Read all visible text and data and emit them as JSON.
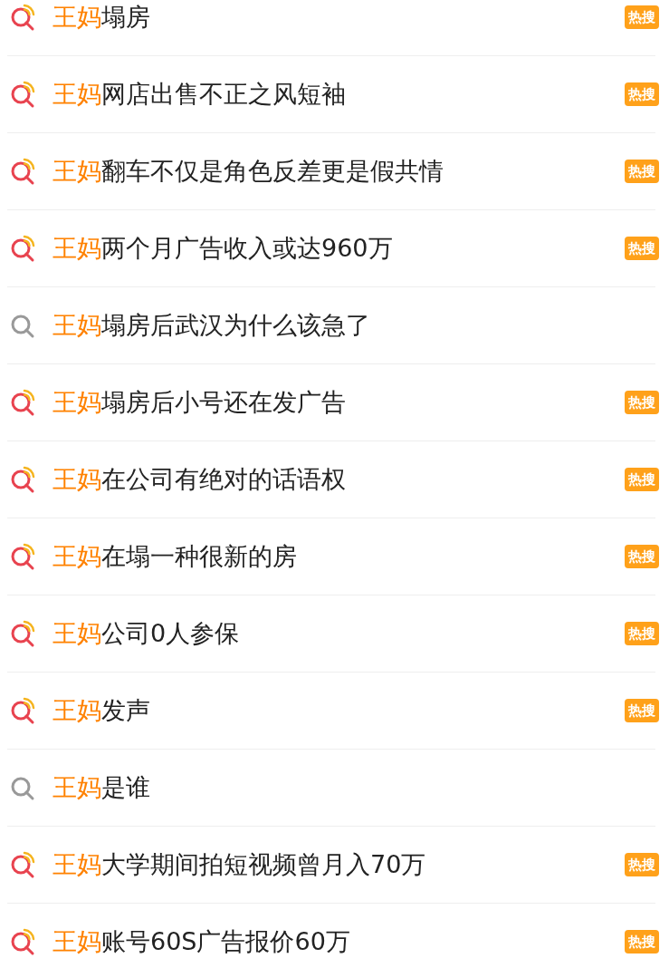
{
  "suggestions": [
    {
      "keyword": "王妈",
      "rest": "塌房",
      "hot": true,
      "badge": "热搜"
    },
    {
      "keyword": "王妈",
      "rest": "网店出售不正之风短袖",
      "hot": true,
      "badge": "热搜"
    },
    {
      "keyword": "王妈",
      "rest": "翻车不仅是角色反差更是假共情",
      "hot": true,
      "badge": "热搜"
    },
    {
      "keyword": "王妈",
      "rest": "两个月广告收入或达960万",
      "hot": true,
      "badge": "热搜"
    },
    {
      "keyword": "王妈",
      "rest": "塌房后武汉为什么该急了",
      "hot": false
    },
    {
      "keyword": "王妈",
      "rest": "塌房后小号还在发广告",
      "hot": true,
      "badge": "热搜"
    },
    {
      "keyword": "王妈",
      "rest": "在公司有绝对的话语权",
      "hot": true,
      "badge": "热搜"
    },
    {
      "keyword": "王妈",
      "rest": "在塌一种很新的房",
      "hot": true,
      "badge": "热搜"
    },
    {
      "keyword": "王妈",
      "rest": "公司0人参保",
      "hot": true,
      "badge": "热搜"
    },
    {
      "keyword": "王妈",
      "rest": "发声",
      "hot": true,
      "badge": "热搜"
    },
    {
      "keyword": "王妈",
      "rest": "是谁",
      "hot": false
    },
    {
      "keyword": "王妈",
      "rest": "大学期间拍短视频曾月入70万",
      "hot": true,
      "badge": "热搜"
    },
    {
      "keyword": "王妈",
      "rest": "账号60S广告报价60万",
      "hot": true,
      "badge": "热搜"
    }
  ]
}
